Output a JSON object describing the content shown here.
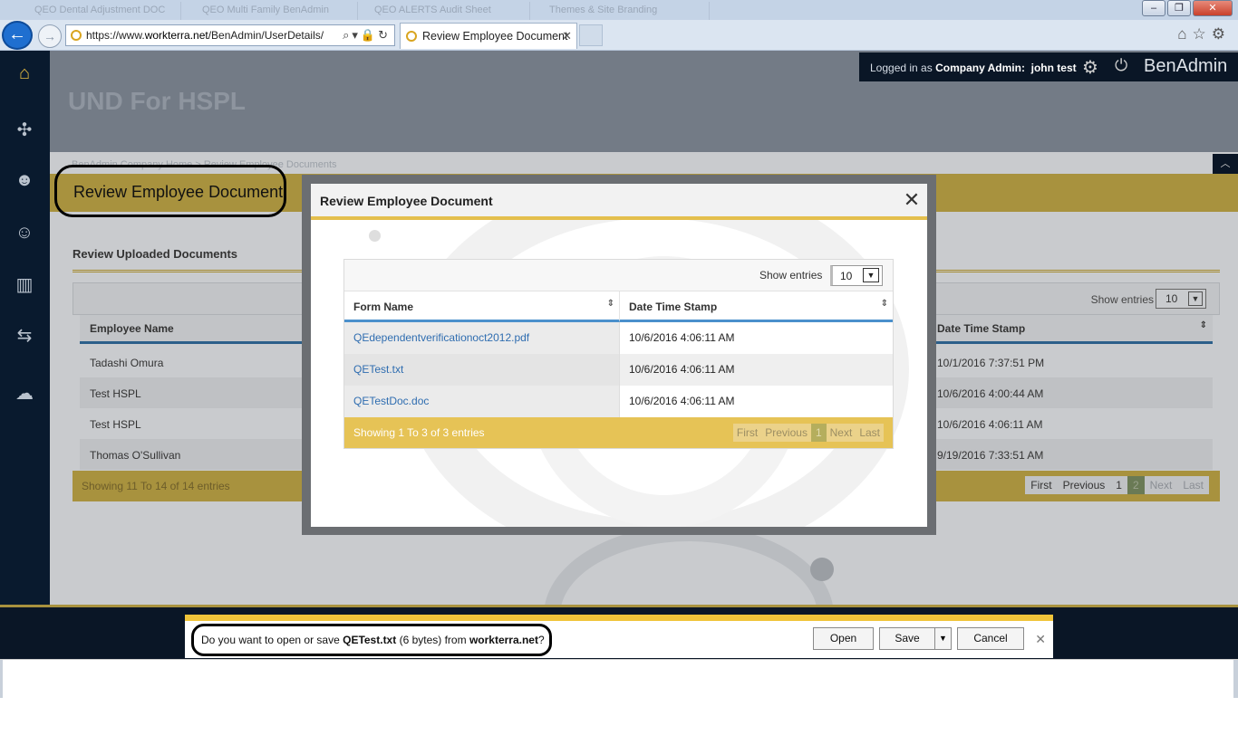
{
  "browser": {
    "background_tabs": [
      "QEO Dental Adjustment DOC",
      "QEO Multi Family BenAdmin",
      "QEO ALERTS Audit Sheet",
      "Themes & Site Branding"
    ],
    "url_scheme": "https://www.",
    "url_host": "workterra.net",
    "url_path": "/BenAdmin/UserDetails/",
    "active_tab_label": "Review Employee Document",
    "window_controls": [
      "minimize",
      "restore",
      "close"
    ]
  },
  "sidebar": {
    "items": [
      "home-icon",
      "puzzle-icon",
      "user-star-icon",
      "user-icon",
      "bar-chart-icon",
      "transfer-icon",
      "chat-icon"
    ]
  },
  "header": {
    "company_name": "UND For HSPL",
    "login_prefix": "Logged in as",
    "login_role": "Company Admin:",
    "login_user": "john test",
    "brand": "BenAdmin",
    "breadcrumb": "BenAdmin Company Home  >  Review Employee Documents"
  },
  "page": {
    "title": "Review Employee Document",
    "section_title": "Review Uploaded Documents",
    "show_entries_label": "Show entries",
    "show_entries_value": "10",
    "columns": [
      "Employee Name",
      "Date Time Stamp"
    ],
    "rows": [
      {
        "name": "Tadashi Omura",
        "timestamp": "10/1/2016 7:37:51 PM"
      },
      {
        "name": "Test HSPL",
        "timestamp": "10/6/2016 4:00:44 AM"
      },
      {
        "name": "Test HSPL",
        "timestamp": "10/6/2016 4:06:11 AM"
      },
      {
        "name": "Thomas O'Sullivan",
        "timestamp": "9/19/2016 7:33:51 AM"
      }
    ],
    "footer_info": "Showing 11 To 14 of 14 entries",
    "pager": [
      "First",
      "Previous",
      "1",
      "2",
      "Next",
      "Last"
    ]
  },
  "modal": {
    "title": "Review Employee Document",
    "show_entries_label": "Show entries",
    "show_entries_value": "10",
    "columns": [
      "Form Name",
      "Date Time Stamp"
    ],
    "rows": [
      {
        "form": "QEdependentverificationoct2012.pdf",
        "timestamp": "10/6/2016 4:06:11 AM"
      },
      {
        "form": "QETest.txt",
        "timestamp": "10/6/2016 4:06:11 AM"
      },
      {
        "form": "QETestDoc.doc",
        "timestamp": "10/6/2016 4:06:11 AM"
      }
    ],
    "footer_info": "Showing 1 To 3 of 3 entries",
    "pager": [
      "First",
      "Previous",
      "1",
      "Next",
      "Last"
    ]
  },
  "download": {
    "prefix": "Do you want to open or save",
    "filename": "QETest.txt",
    "size": "(6 bytes) from",
    "host": "workterra.net",
    "suffix": "?",
    "open_label": "Open",
    "save_label": "Save",
    "cancel_label": "Cancel"
  },
  "colors": {
    "sidebar": "#091a2e",
    "accent_gold": "#e4bf4d",
    "link_blue": "#2f6db0",
    "header_underline": "#4a90cc"
  }
}
